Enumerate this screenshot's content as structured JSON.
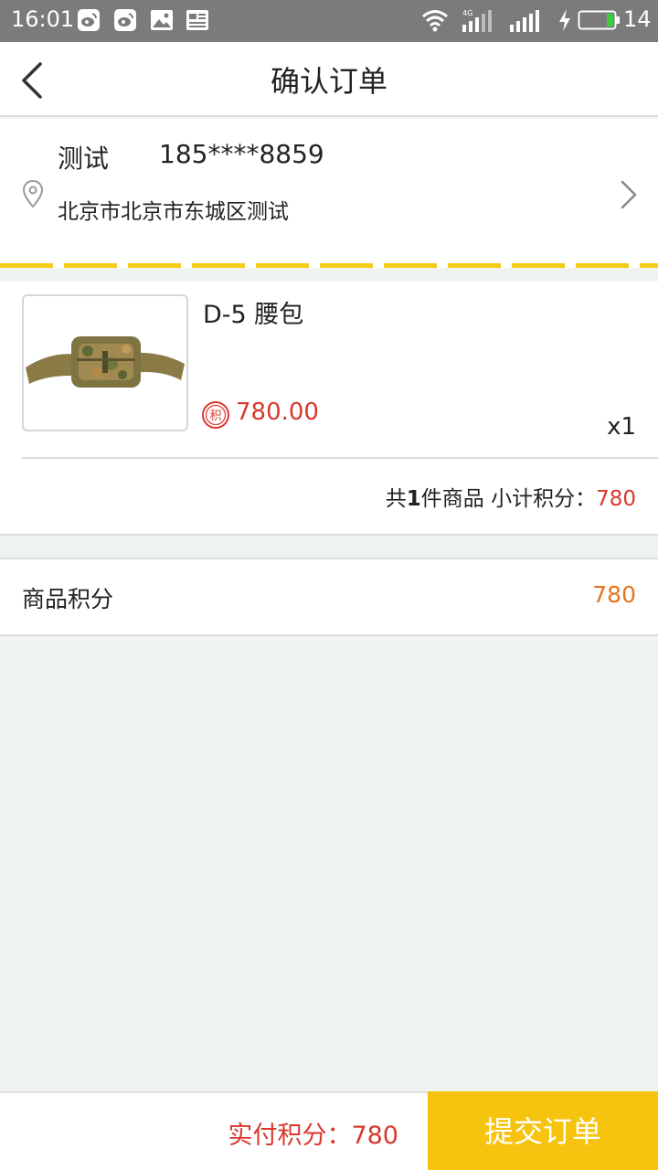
{
  "status_bar": {
    "time": "16:01",
    "network": "4G",
    "battery": "14",
    "icons": [
      "weibo-icon",
      "weibo-icon",
      "image-icon",
      "news-icon",
      "wifi-icon",
      "signal-icon",
      "charging-icon",
      "battery-icon"
    ]
  },
  "header": {
    "title": "确认订单",
    "back_icon": "chevron-left-icon"
  },
  "address": {
    "name": "测试",
    "phone": "185****8859",
    "full": "北京市北京市东城区测试",
    "pin_icon": "location-pin-icon",
    "arrow_icon": "chevron-right-icon"
  },
  "product": {
    "name": "D-5 腰包",
    "price": "780.00",
    "price_badge": "积",
    "quantity": "x1",
    "summary_prefix": "共",
    "summary_count": "1",
    "summary_suffix": "件商品",
    "subtotal_label": "小计积分：",
    "subtotal_value": "780"
  },
  "points": {
    "label": "商品积分",
    "value": "780"
  },
  "footer": {
    "pay_label": "实付积分：",
    "pay_value": "780",
    "submit_label": "提交订单"
  },
  "colors": {
    "accent_yellow": "#f6c40f",
    "price_red": "#d9382d",
    "points_orange": "#e5731e",
    "background": "#eff4f1"
  }
}
